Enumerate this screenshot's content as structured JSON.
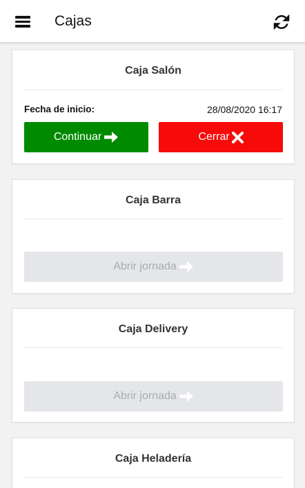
{
  "appbar": {
    "title": "Cajas",
    "menu_icon": "hamburger-menu-icon",
    "refresh_icon": "refresh-icon"
  },
  "cajas": [
    {
      "title": "Caja Salón",
      "status": "open",
      "start_label": "Fecha de inicio:",
      "start_value": "28/08/2020 16:17",
      "continue_label": "Continuar",
      "close_label": "Cerrar"
    },
    {
      "title": "Caja Barra",
      "status": "closed",
      "open_label": "Abrir jornada"
    },
    {
      "title": "Caja Delivery",
      "status": "closed",
      "open_label": "Abrir jornada"
    },
    {
      "title": "Caja Heladería"
    }
  ],
  "colors": {
    "continue": "#008a00",
    "close": "#f70a0a",
    "disabled_bg": "#e4e6e9",
    "disabled_text": "#a9abae"
  }
}
